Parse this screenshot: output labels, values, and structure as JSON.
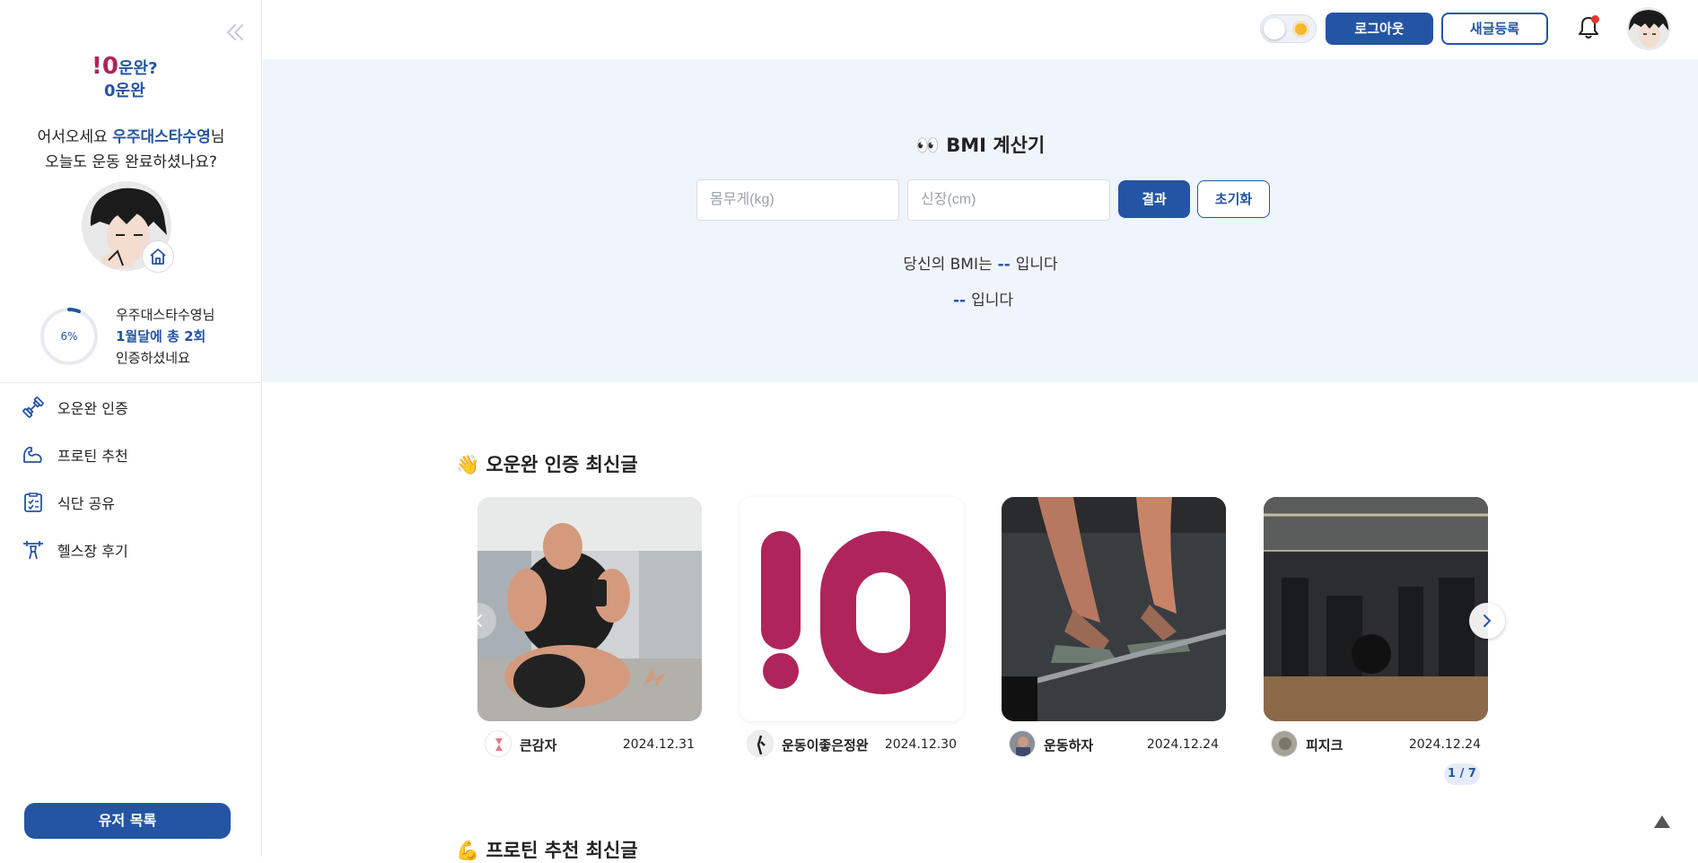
{
  "app": {
    "logo_text_top": "!0운완?",
    "logo_text_bottom": "0운완"
  },
  "sidebar": {
    "greeting_prefix": "어서오세요",
    "user_name": "우주대스타수영",
    "greeting_suffix": "님",
    "greeting_line2": "오늘도 운동 완료하셨나요?",
    "progress_label": "6%",
    "progress_value": 0.06,
    "stat_line1": "우주대스타수영님",
    "stat_line2": "1월달에 총 2회",
    "stat_line3": "인증하셨네요",
    "nav": [
      {
        "label": "오운완 인증",
        "icon": "dumbbell-icon"
      },
      {
        "label": "프로틴 추천",
        "icon": "muscle-arm-icon"
      },
      {
        "label": "식단 공유",
        "icon": "checklist-icon"
      },
      {
        "label": "헬스장 후기",
        "icon": "barbell-icon"
      }
    ],
    "user_list_button": "유저 목록"
  },
  "header": {
    "logout_label": "로그아웃",
    "new_post_label": "새글등록",
    "theme_toggle_icon": "sun-icon",
    "notification_icon": "bell-icon"
  },
  "bmi": {
    "title": "👀 BMI 계산기",
    "weight_placeholder": "몸무게(kg)",
    "height_placeholder": "신장(cm)",
    "result_button": "결과",
    "reset_button": "초기화",
    "result_prefix": "당신의 BMI는",
    "result_value": "--",
    "result_suffix": "입니다",
    "category_value": "--",
    "category_suffix": "입니다"
  },
  "latest_posts": {
    "title": "👋 오운완 인증 최신글",
    "pager": "1 / 7",
    "cards": [
      {
        "author": "큰감자",
        "date": "2024.12.31"
      },
      {
        "author": "운동이좋은정완",
        "date": "2024.12.30"
      },
      {
        "author": "운동하자",
        "date": "2024.12.24"
      },
      {
        "author": "피지크",
        "date": "2024.12.24"
      }
    ]
  },
  "next_section": {
    "title": "💪 프로틴 추천 최신글"
  },
  "colors": {
    "primary": "#2455a4",
    "bmi_bg": "#f0f4fb",
    "brand_magenta": "#b0245c"
  }
}
